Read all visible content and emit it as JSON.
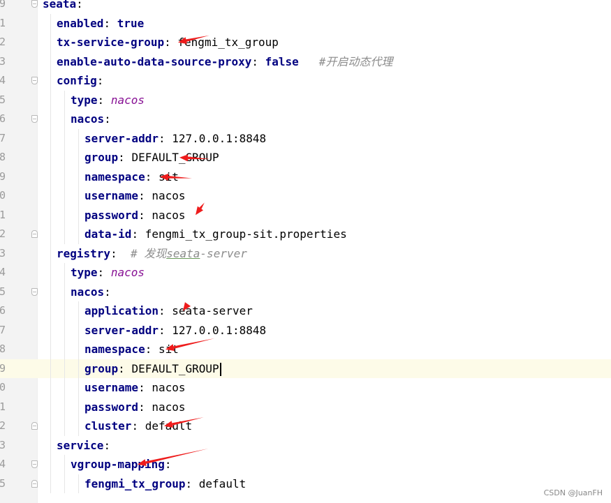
{
  "editor": {
    "current_line_index": 19,
    "lines": [
      {
        "num": "9",
        "indent": 0,
        "key": "seata",
        "fold": "start"
      },
      {
        "num": "1",
        "indent": 1,
        "key": "enabled",
        "value": "true",
        "value_style": "bool"
      },
      {
        "num": "2",
        "indent": 1,
        "key": "tx-service-group",
        "value": "fengmi_tx_group"
      },
      {
        "num": "3",
        "indent": 1,
        "key": "enable-auto-data-source-proxy",
        "value": "false",
        "value_style": "bool",
        "comment": "#开启动态代理"
      },
      {
        "num": "4",
        "indent": 1,
        "key": "config",
        "fold": "start"
      },
      {
        "num": "5",
        "indent": 2,
        "key": "type",
        "value": "nacos",
        "value_style": "italic"
      },
      {
        "num": "6",
        "indent": 2,
        "key": "nacos",
        "fold": "start"
      },
      {
        "num": "7",
        "indent": 3,
        "key": "server-addr",
        "value": "127.0.0.1:8848"
      },
      {
        "num": "8",
        "indent": 3,
        "key": "group",
        "value": "DEFAULT_GROUP"
      },
      {
        "num": "9",
        "indent": 3,
        "key": "namespace",
        "value": "sit"
      },
      {
        "num": "0",
        "indent": 3,
        "key": "username",
        "value": "nacos"
      },
      {
        "num": "1",
        "indent": 3,
        "key": "password",
        "value": "nacos"
      },
      {
        "num": "2",
        "indent": 3,
        "key": "data-id",
        "value": "fengmi_tx_group-sit.properties",
        "fold": "end"
      },
      {
        "num": "3",
        "indent": 1,
        "key": "registry",
        "comment_pre": "# 发现",
        "comment_u": "seata",
        "comment_post": "-server"
      },
      {
        "num": "4",
        "indent": 2,
        "key": "type",
        "value": "nacos",
        "value_style": "italic"
      },
      {
        "num": "5",
        "indent": 2,
        "key": "nacos",
        "fold": "start"
      },
      {
        "num": "6",
        "indent": 3,
        "key": "application",
        "value": "seata-server"
      },
      {
        "num": "7",
        "indent": 3,
        "key": "server-addr",
        "value": "127.0.0.1:8848"
      },
      {
        "num": "8",
        "indent": 3,
        "key": "namespace",
        "value": "sit"
      },
      {
        "num": "9",
        "indent": 3,
        "key": "group",
        "value": "DEFAULT_GROUP"
      },
      {
        "num": "0",
        "indent": 3,
        "key": "username",
        "value": "nacos"
      },
      {
        "num": "1",
        "indent": 3,
        "key": "password",
        "value": "nacos"
      },
      {
        "num": "2",
        "indent": 3,
        "key": "cluster",
        "value": "default",
        "fold": "end"
      },
      {
        "num": "3",
        "indent": 1,
        "key": "service"
      },
      {
        "num": "4",
        "indent": 2,
        "key": "vgroup-mapping",
        "fold": "start"
      },
      {
        "num": "5",
        "indent": 3,
        "key": "fengmi_tx_group",
        "value": "default",
        "fold": "end"
      }
    ]
  },
  "annotations": {
    "arrow_color": "#ee1c1c",
    "arrows": [
      {
        "line": 2,
        "tip_col": 17.4,
        "len": 2.3,
        "dir": "up"
      },
      {
        "line": 8,
        "tip_col": 13.6,
        "len": 2.2,
        "dir": "flat"
      },
      {
        "line": 9,
        "tip_col": 10.8,
        "len": 2.3,
        "dir": "flat"
      },
      {
        "line": 11,
        "tip_col": 15.9,
        "len": 1.1,
        "dir": "steep"
      },
      {
        "line": 16,
        "tip_col": 14.1,
        "len": 0.6,
        "dir": "steep"
      },
      {
        "line": 18,
        "tip_col": 11.6,
        "len": 3.6,
        "dir": "up"
      },
      {
        "line": 22,
        "tip_col": 11.4,
        "len": 2.9,
        "dir": "up"
      },
      {
        "line": 24,
        "tip_col": 9.6,
        "len": 5.2,
        "dir": "up"
      }
    ]
  },
  "watermark": "CSDN @JuanFH"
}
